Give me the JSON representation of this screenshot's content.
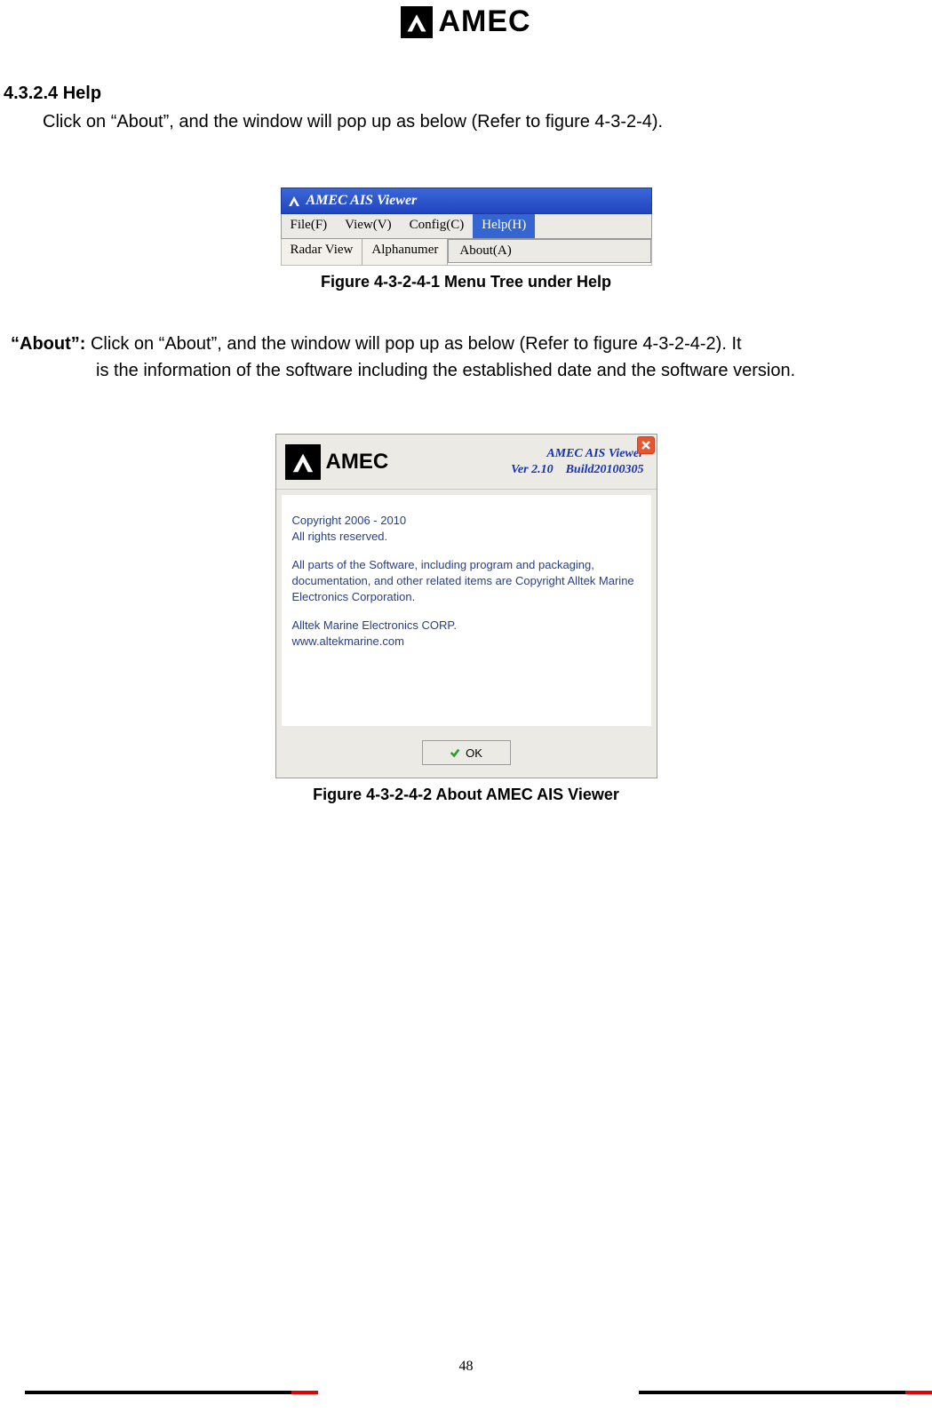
{
  "header": {
    "brand": "AMEC"
  },
  "section": {
    "number_title": "4.3.2.4 Help",
    "intro": "Click on “About”, and the window will pop up as below (Refer to figure 4-3-2-4)."
  },
  "figure1": {
    "title": "AMEC AIS Viewer",
    "menu": {
      "file": "File(F)",
      "view": "View(V)",
      "config": "Config(C)",
      "help": "Help(H)"
    },
    "tabs": {
      "radar": "Radar View",
      "alpha": "Alphanumer"
    },
    "dropdown": {
      "about": "About(A)"
    },
    "caption": "Figure 4-3-2-4-1 Menu Tree under Help"
  },
  "about_para": {
    "label": "“About”:",
    "line1": "Click on “About”, and the window will pop up as below (Refer to figure 4-3-2-4-2). It",
    "line2": "is the information of the software including the established date and the software version."
  },
  "figure2": {
    "brand": "AMEC",
    "product": "AMEC AIS Viewer",
    "ver_line": "Ver 2.10 Build20100305",
    "body1": "Copyright 2006 - 2010",
    "body2": "All rights reserved.",
    "body3": "All parts of the Software, including program and packaging, documentation, and other related items are Copyright Alltek Marine Electronics Corporation.",
    "body4": "Alltek Marine Electronics CORP.",
    "body5": "www.altekmarine.com",
    "ok": "OK",
    "caption": "Figure 4-3-2-4-2 About AMEC AIS Viewer"
  },
  "page_number": "48"
}
